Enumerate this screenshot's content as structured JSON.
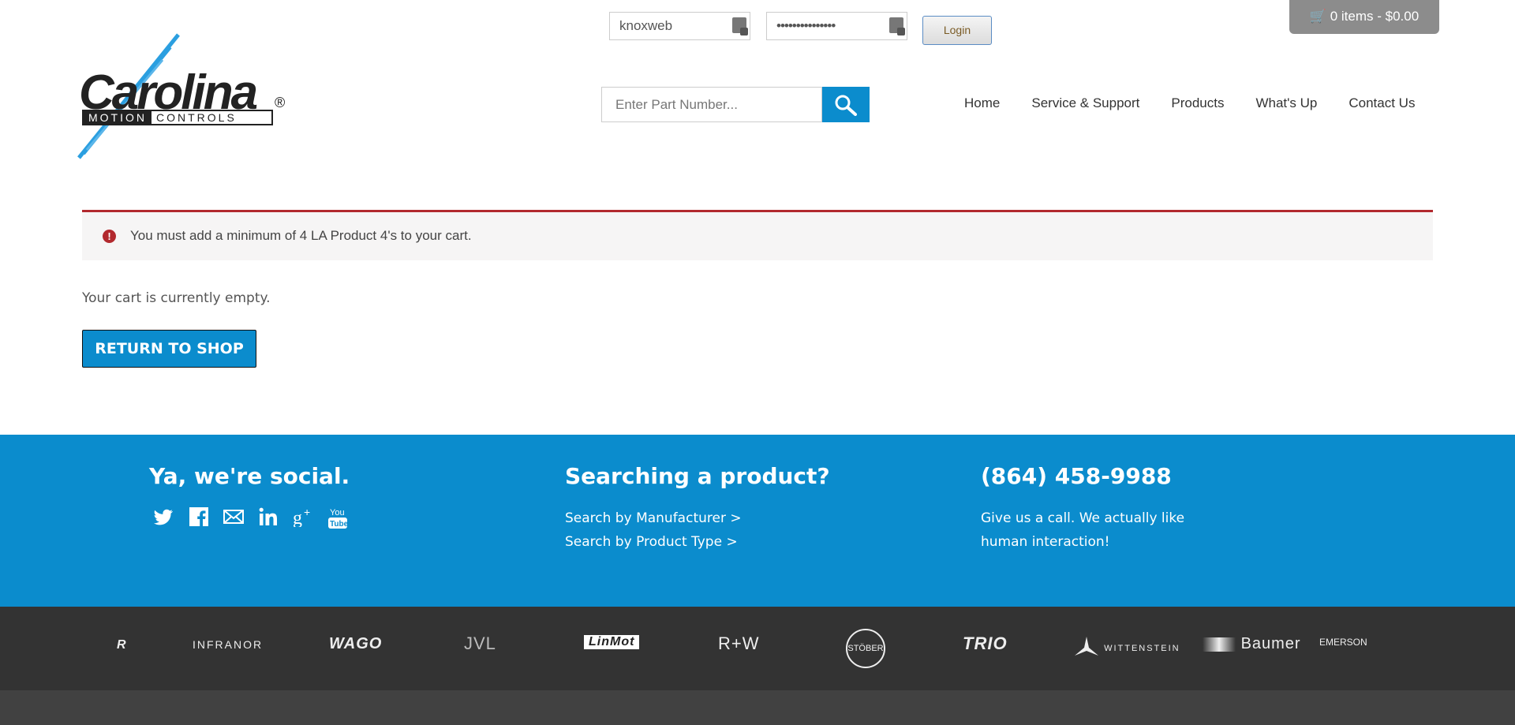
{
  "header": {
    "logo": {
      "wordmark": "Carolina",
      "sub_left": "MOTION",
      "sub_right": "CONTROLS",
      "reg": "®"
    },
    "login": {
      "username": "knoxweb",
      "password": "•••••••••••••••",
      "button": "Login"
    },
    "cart": {
      "label": "0 items - $0.00"
    },
    "search": {
      "placeholder": "Enter Part Number..."
    },
    "nav": [
      "Home",
      "Service & Support",
      "Products",
      "What's Up",
      "Contact Us"
    ]
  },
  "alert": {
    "message": "You must add a minimum of 4 LA Product 4's to your cart."
  },
  "cart_page": {
    "empty_text": "Your cart is currently empty.",
    "return_button": "RETURN TO SHOP"
  },
  "footer": {
    "social_heading": "Ya, we're social.",
    "social_icons": [
      "twitter-icon",
      "facebook-icon",
      "mail-icon",
      "linkedin-icon",
      "google-plus-icon",
      "youtube-icon"
    ],
    "search_heading": "Searching a product?",
    "search_links": [
      "Search by Manufacturer >",
      "Search by Product Type >"
    ],
    "phone_heading": "(864) 458-9988",
    "phone_text_1": "Give us a call. We actually like",
    "phone_text_2": "human interaction!",
    "brands": [
      "INFRANOR",
      "WAGO",
      "JVL",
      "LinMot",
      "R+W",
      "STÖBER",
      "TRIO",
      "WITTENSTEIN",
      "Baumer",
      "EMERSON"
    ]
  },
  "colors": {
    "primary_blue": "#0b8ccd",
    "alert_red": "#b2292e",
    "cart_gray": "#8c8c8c",
    "dark_footer": "#333333"
  }
}
